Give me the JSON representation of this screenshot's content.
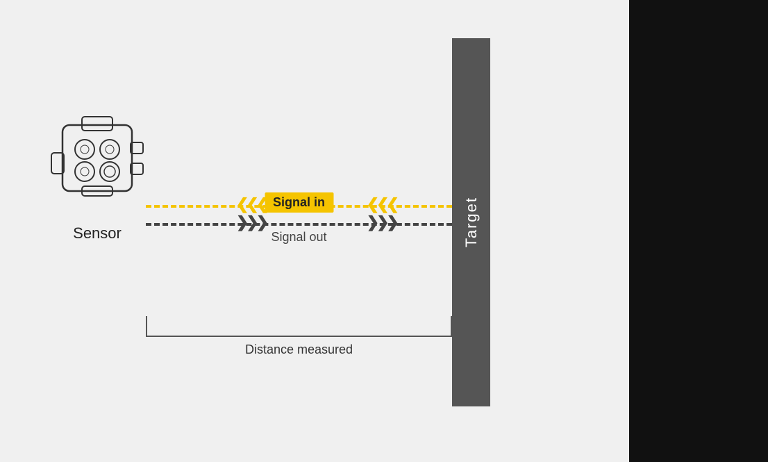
{
  "diagram": {
    "sensor_label": "Sensor",
    "target_label": "Target",
    "signal_in_label": "Signal in",
    "signal_out_label": "Signal out",
    "distance_label": "Distance measured",
    "colors": {
      "yellow": "#f5c400",
      "dark": "#444444",
      "target_bg": "#555555",
      "background": "#f0f0f0"
    }
  }
}
